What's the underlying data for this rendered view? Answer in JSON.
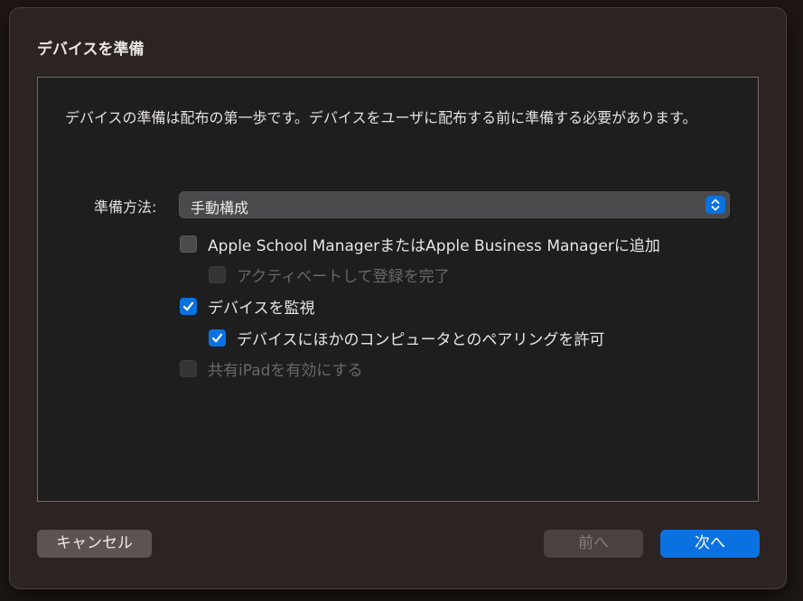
{
  "dialog": {
    "title": "デバイスを準備",
    "description": "デバイスの準備は配布の第一歩です。デバイスをユーザに配布する前に準備する必要があります。"
  },
  "method": {
    "label": "準備方法:",
    "value": "手動構成"
  },
  "options": {
    "add_to_manager": {
      "label": "Apple School ManagerまたはApple Business Managerに追加",
      "checked": false,
      "enabled": true
    },
    "activate_complete": {
      "label": "アクティベートして登録を完了",
      "checked": false,
      "enabled": false
    },
    "supervise": {
      "label": "デバイスを監視",
      "checked": true,
      "enabled": true
    },
    "allow_pairing": {
      "label": "デバイスにほかのコンピュータとのペアリングを許可",
      "checked": true,
      "enabled": true
    },
    "shared_ipad": {
      "label": "共有iPadを有効にする",
      "checked": false,
      "enabled": false
    }
  },
  "buttons": {
    "cancel": "キャンセル",
    "previous": "前へ",
    "next": "次へ"
  },
  "colors": {
    "accent": "#0a72e0",
    "sheet": "#2c2422",
    "panel": "#1e1e1e"
  }
}
